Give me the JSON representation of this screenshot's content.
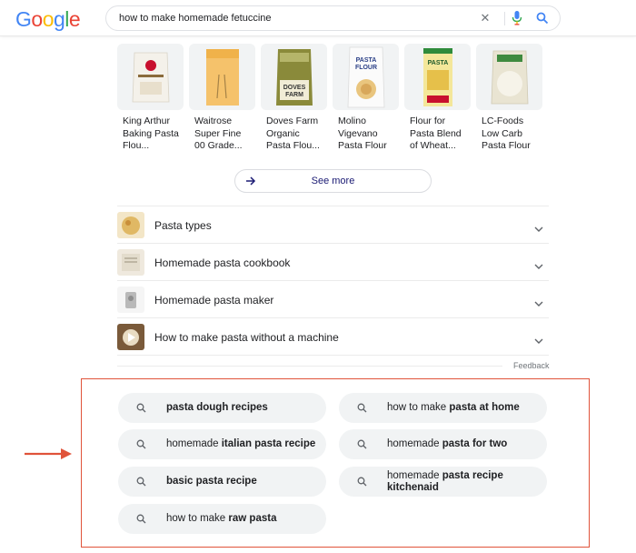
{
  "logo": {
    "letters": [
      "G",
      "o",
      "o",
      "g",
      "l",
      "e"
    ],
    "colors": [
      "#4285f4",
      "#ea4335",
      "#fbbc05",
      "#4285f4",
      "#34a853",
      "#ea4335"
    ]
  },
  "search": {
    "query": "how to make homemade fetuccine",
    "clear_glyph": "✕"
  },
  "products": [
    {
      "name_line1": "King Arthur",
      "name_line2": "Baking Pasta",
      "name_line3": "Flou...",
      "pkg_label": "Pasta Flour"
    },
    {
      "name_line1": "Waitrose",
      "name_line2": "Super Fine",
      "name_line3": "00 Grade..."
    },
    {
      "name_line1": "Doves Farm",
      "name_line2": "Organic",
      "name_line3": "Pasta Flou...",
      "pkg_label_1": "DOVES",
      "pkg_label_2": "FARM"
    },
    {
      "name_line1": "Molino",
      "name_line2": "Vigevano",
      "name_line3": "Pasta Flour",
      "pkg_label_1": "PASTA",
      "pkg_label_2": "FLOUR"
    },
    {
      "name_line1": "Flour for",
      "name_line2": "Pasta Blend",
      "name_line3": "of Wheat...",
      "pkg_label_1": "PASTA"
    },
    {
      "name_line1": "LC-Foods",
      "name_line2": "Low Carb",
      "name_line3": "Pasta Flour"
    }
  ],
  "see_more": {
    "label": "See more"
  },
  "topics": [
    {
      "label": "Pasta types"
    },
    {
      "label": "Homemade pasta cookbook"
    },
    {
      "label": "Homemade pasta maker"
    },
    {
      "label": "How to make pasta without a machine"
    }
  ],
  "feedback": {
    "label": "Feedback"
  },
  "related": [
    {
      "pre": "",
      "bold": "pasta dough recipes",
      "post": ""
    },
    {
      "pre": "how to make ",
      "bold": "pasta at home",
      "post": ""
    },
    {
      "pre": "homemade ",
      "bold": "italian pasta recipe",
      "post": ""
    },
    {
      "pre": "homemade ",
      "bold": "pasta for two",
      "post": ""
    },
    {
      "pre": "",
      "bold": "basic pasta recipe",
      "post": ""
    },
    {
      "pre": "homemade ",
      "bold": "pasta recipe kitchenaid",
      "post": ""
    },
    {
      "pre": "how to make ",
      "bold": "raw pasta",
      "post": ""
    }
  ],
  "colors": {
    "highlight": "#e0533a",
    "accent_blue": "#4285f4",
    "link": "#1a1a73"
  }
}
